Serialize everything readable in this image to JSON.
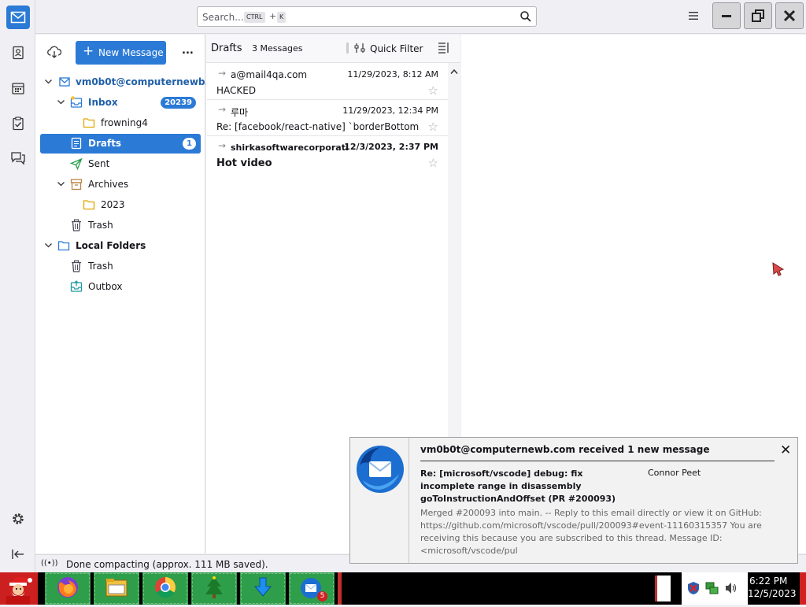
{
  "search": {
    "placeholder": "Search...",
    "kbd_ctrl": "CTRL",
    "kbd_plus": "+",
    "kbd_k": "K"
  },
  "toolbar": {
    "new_message": "New Message",
    "more": "..."
  },
  "folders": {
    "account": "vm0b0t@computernewb...",
    "inbox": "Inbox",
    "inbox_count": "20239",
    "frowning4": "frowning4",
    "drafts": "Drafts",
    "drafts_count": "1",
    "sent": "Sent",
    "archives": "Archives",
    "archives_2023": "2023",
    "trash": "Trash",
    "local_folders": "Local Folders",
    "local_trash": "Trash",
    "outbox": "Outbox"
  },
  "list": {
    "folder_name": "Drafts",
    "count": "3 Messages",
    "quick_filter": "Quick Filter",
    "messages": [
      {
        "from": "a@mail4qa.com",
        "date": "11/29/2023, 8:12 AM",
        "subject": "HACKED",
        "bold": false
      },
      {
        "from": "루마",
        "date": "11/29/2023, 12:34 PM",
        "subject": "Re: [facebook/react-native] `borderBottom...",
        "bold": false
      },
      {
        "from": "shirkasoftwarecorporatio...",
        "date": "12/3/2023, 2:37 PM",
        "subject": "Hot video",
        "bold": true
      }
    ]
  },
  "status": {
    "text": "Done compacting (approx. 111 MB saved)."
  },
  "notification": {
    "title": "vm0b0t@computernewb.com received 1 new message",
    "subject": "Re: [microsoft/vscode] debug: fix incomplete range in disassembly goToInstructionAndOffset (PR #200093)",
    "author": "Connor Peet",
    "body": "Merged #200093 into main. -- Reply to this email directly or view it on GitHub: https://github.com/microsoft/vscode/pull/200093#event-11160315357 You are receiving this because you are subscribed to this thread. Message ID: <microsoft/vscode/pul",
    "close": "✕"
  },
  "taskbar": {
    "time": "6:22 PM",
    "date": "12/5/2023",
    "thunderbird_badge": "5"
  },
  "colors": {
    "accent": "#2b7ad6",
    "taskbar_green": "#2f9e4a"
  }
}
